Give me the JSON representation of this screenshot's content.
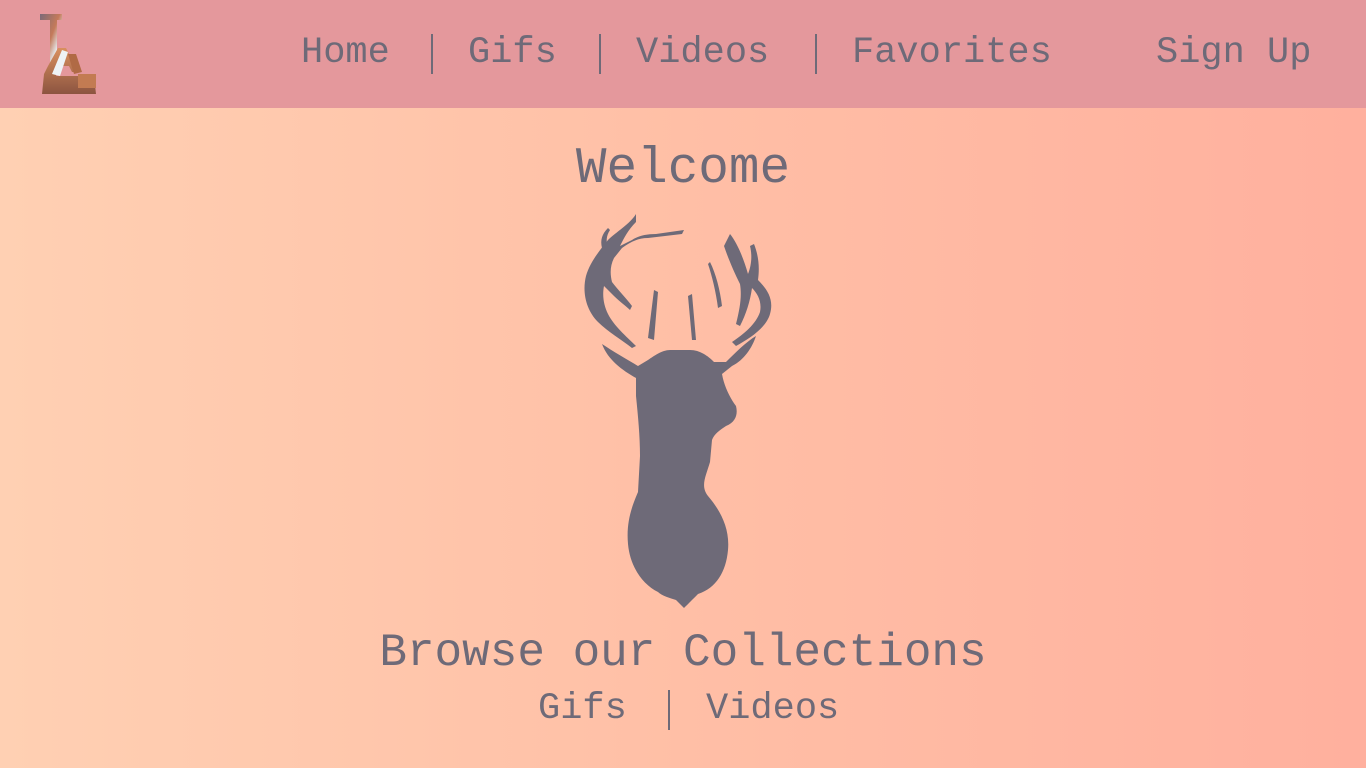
{
  "header": {
    "logo_icon": "la-logo-icon",
    "nav": {
      "home": "Home",
      "gifs": "Gifs",
      "videos": "Videos",
      "favorites": "Favorites",
      "signup": "Sign Up"
    }
  },
  "main": {
    "welcome": "Welcome",
    "hero_icon": "deer-head-icon",
    "browse_title": "Browse our Collections",
    "links": {
      "gifs": "Gifs",
      "videos": "Videos"
    }
  },
  "colors": {
    "header_bg": "#e4989c",
    "text": "#6e6a78",
    "bg_start": "#ffd0b3",
    "bg_end": "#ffb09e"
  }
}
